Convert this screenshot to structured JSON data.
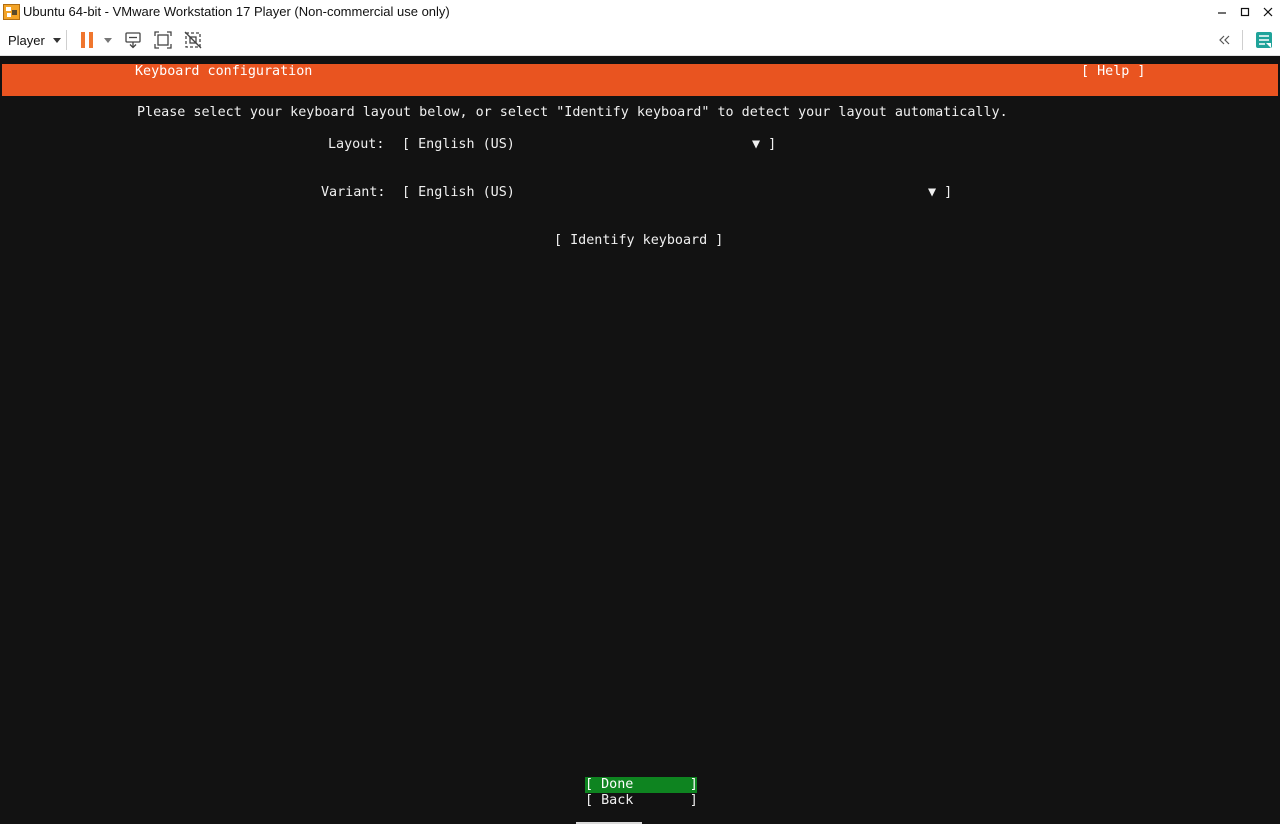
{
  "window": {
    "title": "Ubuntu 64-bit - VMware Workstation 17 Player (Non-commercial use only)",
    "icon": "vmware-player-icon",
    "controls": [
      "minimize-icon",
      "maximize-icon",
      "close-icon"
    ]
  },
  "toolbar": {
    "player_menu_label": "Player",
    "buttons": [
      "pause-icon",
      "dropdown-arrow-icon",
      "send-ctrl-alt-del-icon",
      "full-screen-icon",
      "unity-icon"
    ],
    "right_buttons": [
      "collapse-toolbar-icon",
      "message-log-icon"
    ],
    "accent_color": "#f0762e",
    "right_accent_color": "#1fa39a"
  },
  "installer": {
    "header_title": "Keyboard configuration",
    "help_label": "[ Help ]",
    "instructions": "Please select your keyboard layout below, or select \"Identify keyboard\" to detect your layout automatically.",
    "layout_label": "Layout:",
    "layout_value": "[ English (US)",
    "variant_label": "Variant:",
    "variant_value": "[ English (US)",
    "select_arrow": "▼ ]",
    "identify_label": "[ Identify keyboard ]",
    "done_label": "[ Done       ]",
    "back_label": "[ Back       ]",
    "header_color": "#e95420",
    "done_color": "#0e8420",
    "background_color": "#121212"
  }
}
